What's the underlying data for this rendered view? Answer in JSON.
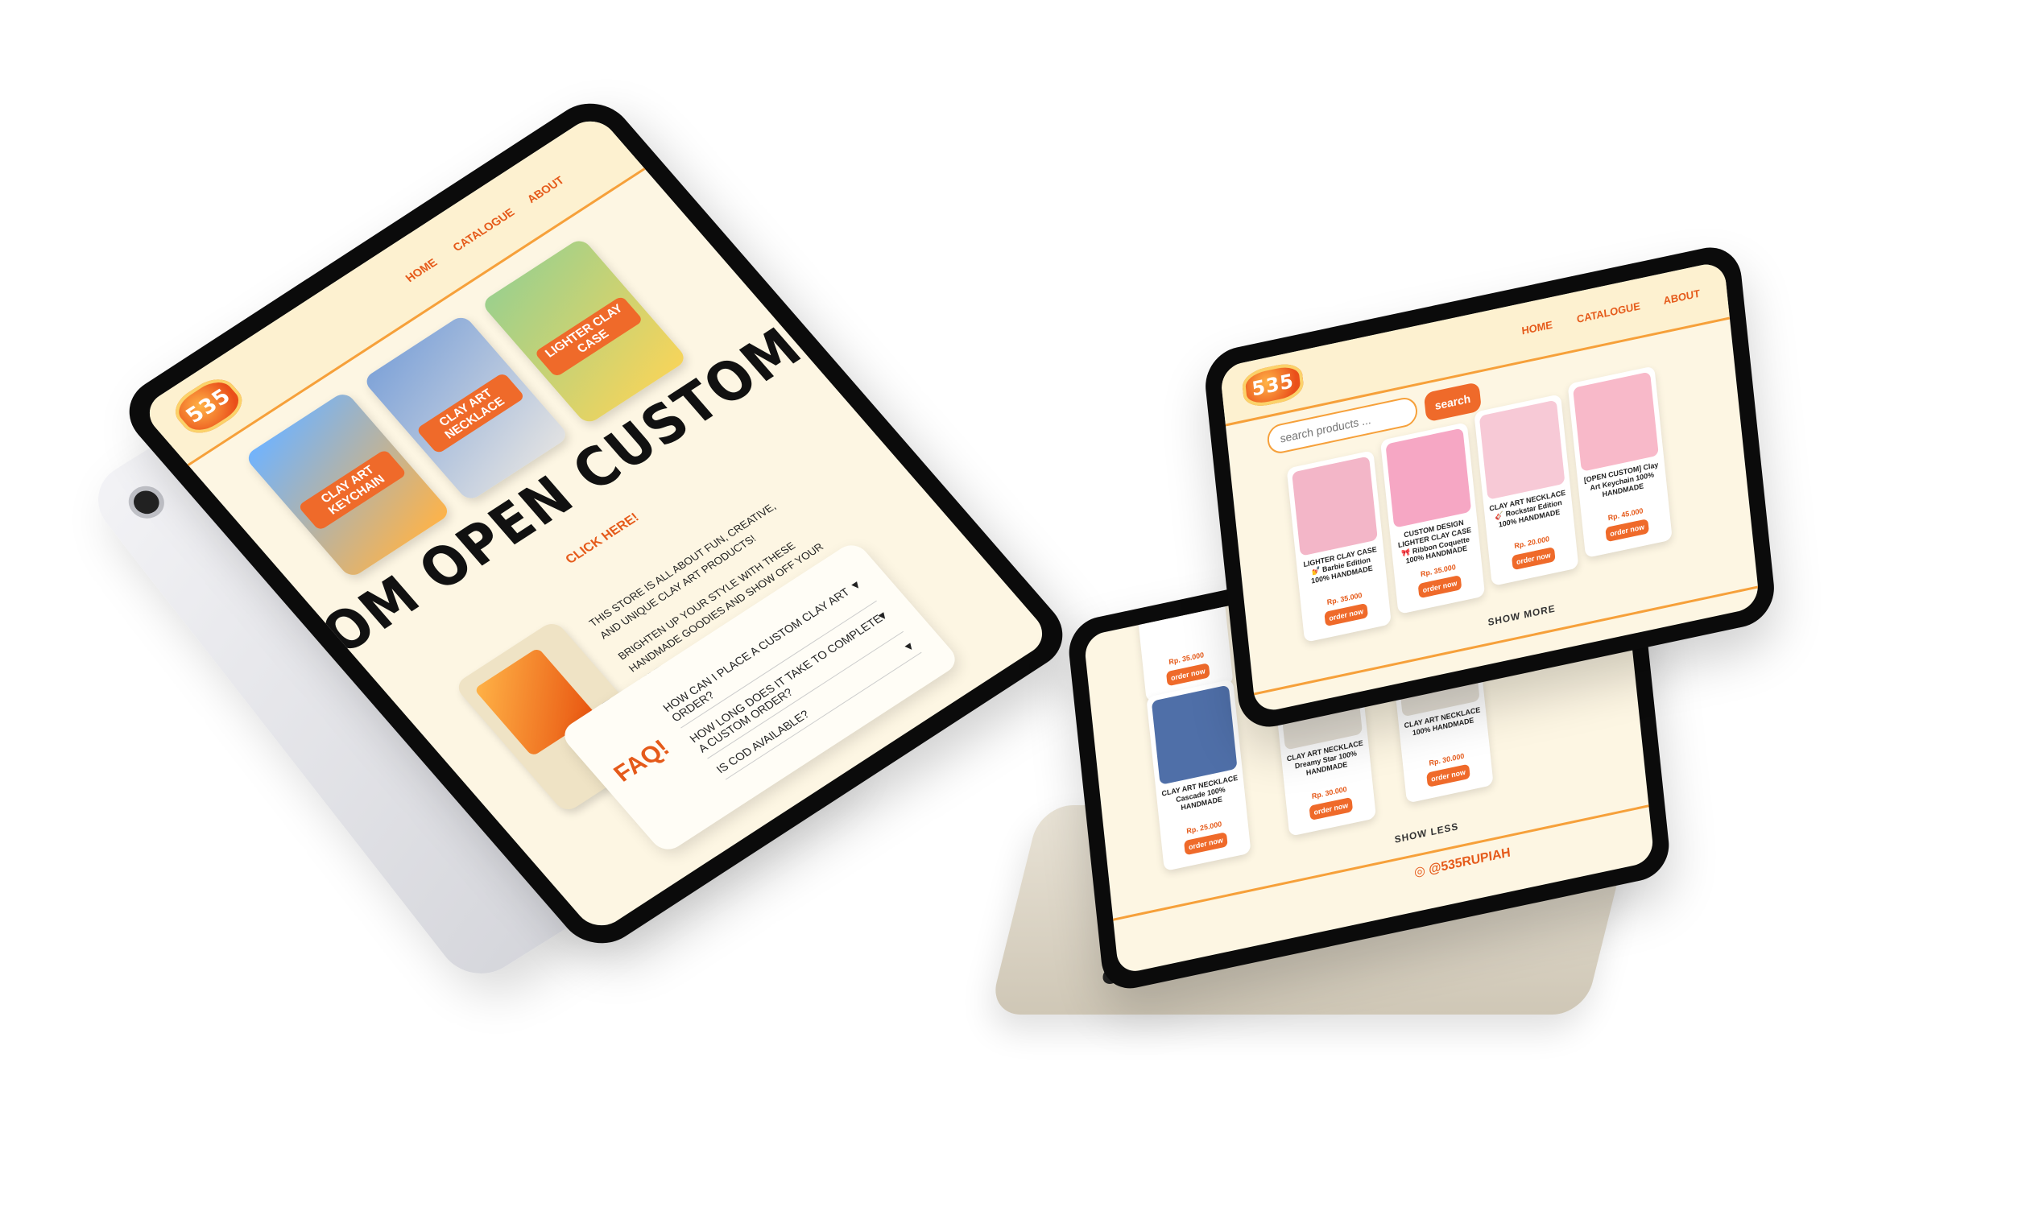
{
  "brand": {
    "logo_text": "535"
  },
  "nav": {
    "home": "HOME",
    "catalogue": "CATALOGUE",
    "about": "ABOUT"
  },
  "left_tablet": {
    "hero_cards": [
      {
        "label": "CLAY ART KEYCHAIN"
      },
      {
        "label": "CLAY ART NECKLACE"
      },
      {
        "label": "LIGHTER CLAY CASE"
      }
    ],
    "marquee": "OM OPEN CUSTOM OP",
    "click_here": "CLICK HERE!",
    "description": [
      "THIS STORE IS ALL ABOUT FUN, CREATIVE, AND UNIQUE CLAY ART PRODUCTS!",
      "BRIGHTEN UP YOUR STYLE WITH THESE HANDMADE GOODIES AND SHOW OFF YOUR VIBE!"
    ],
    "faq": {
      "title": "FAQ!",
      "questions": [
        "HOW CAN I PLACE A CUSTOM CLAY ART ORDER?",
        "HOW LONG DOES IT TAKE TO COMPLETE A CUSTOM ORDER?",
        "IS COD AVAILABLE?"
      ]
    }
  },
  "right_tablet": {
    "search": {
      "placeholder": "search products ...",
      "button": "search"
    },
    "products": [
      {
        "name": "LIGHTER CLAY CASE 💅 Barbie Edition 100% HANDMADE",
        "price": "Rp. 35.000",
        "order": "order now",
        "color": "#f3b6c8"
      },
      {
        "name": "CUSTOM DESIGN LIGHTER CLAY CASE 🎀 Ribbon Coquette 100% HANDMADE",
        "price": "Rp. 35.000",
        "order": "order now",
        "color": "#f6a7c4"
      },
      {
        "name": "CLAY ART NECKLACE 🎸 Rockstar Edition 100% HANDMADE",
        "price": "Rp. 20.000",
        "order": "order now",
        "color": "#f7c9d6"
      },
      {
        "name": "[OPEN CUSTOM] Clay Art Keychain 100% HANDMADE",
        "price": "Rp. 45.000",
        "order": "order now",
        "color": "#f8b9c9"
      }
    ],
    "show_more": "SHOW MORE"
  },
  "back_tablet": {
    "price_top": "Rp. 35.000",
    "order": "order now",
    "products": [
      {
        "name": "CLAY ART NECKLACE Cascade 100% HANDMADE",
        "price": "Rp. 25.000",
        "color": "#4f6fa8"
      },
      {
        "name": "CLAY ART NECKLACE Dreamy Star 100% HANDMADE",
        "price": "Rp. 30.000",
        "color": "#e5e0d6"
      },
      {
        "name": "CLAY ART NECKLACE 100% HANDMADE",
        "price": "Rp. 30.000",
        "color": "#e5e0d6"
      }
    ],
    "show_less": "SHOW LESS",
    "instagram": "@535RUPIAH"
  },
  "colors": {
    "accent": "#ef6a2a",
    "background": "#fdf6e3",
    "border": "#f6a03a"
  }
}
